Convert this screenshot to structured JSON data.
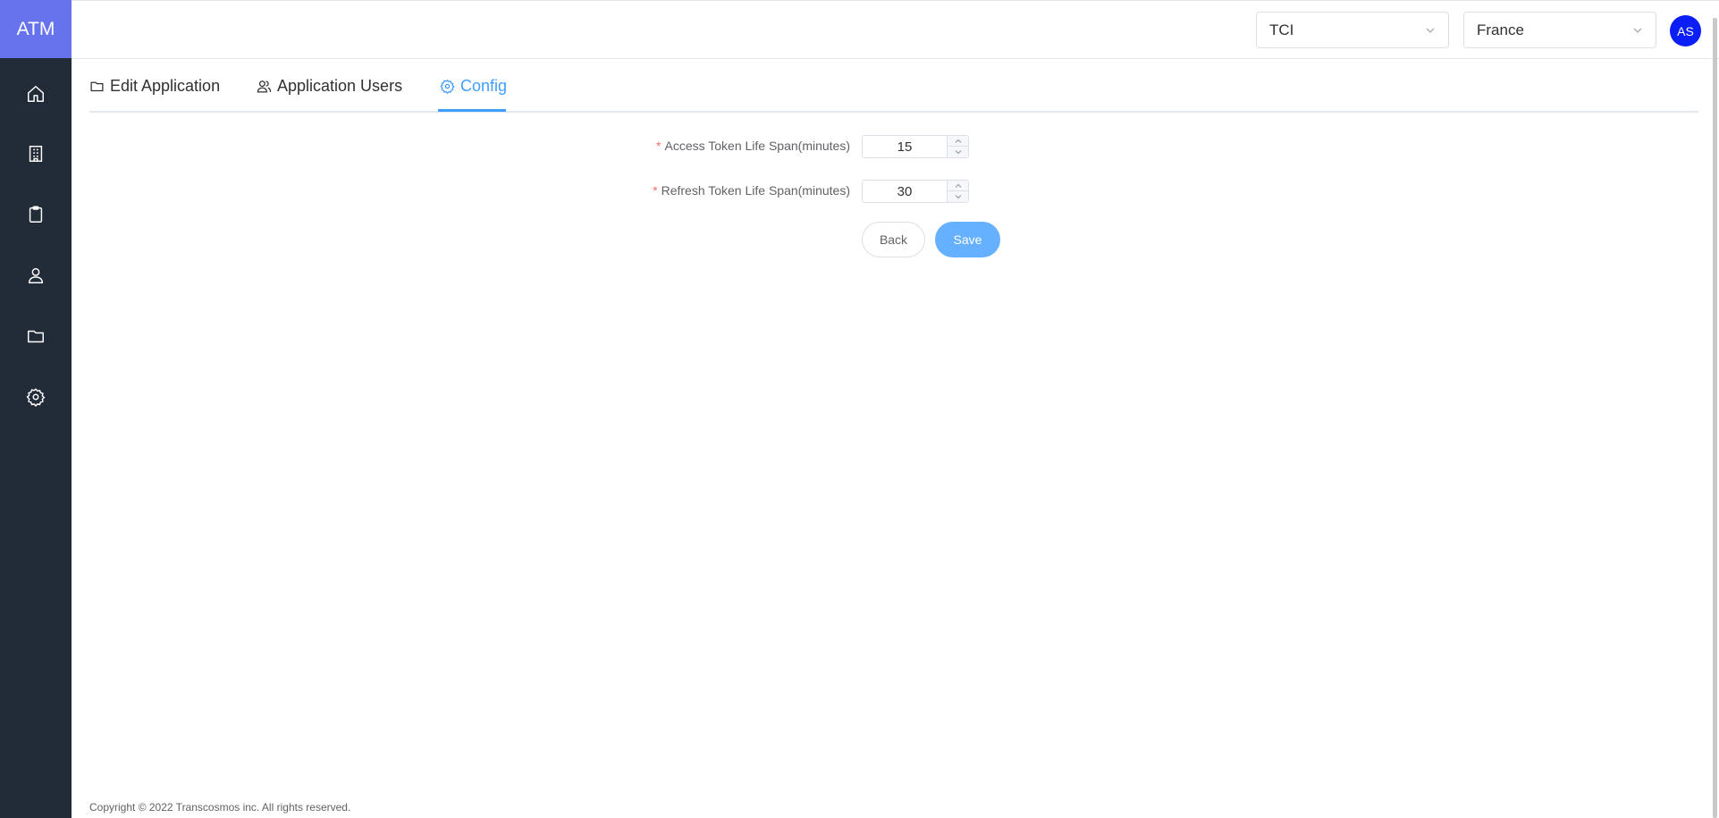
{
  "app": {
    "logo": "ATM"
  },
  "sidebar": {
    "items": [
      {
        "icon": "home-icon",
        "name": "sidebar-item-home"
      },
      {
        "icon": "building-icon",
        "name": "sidebar-item-organization"
      },
      {
        "icon": "clipboard-icon",
        "name": "sidebar-item-applications"
      },
      {
        "icon": "user-icon",
        "name": "sidebar-item-users"
      },
      {
        "icon": "folder-icon",
        "name": "sidebar-item-folders"
      },
      {
        "icon": "gear-icon",
        "name": "sidebar-item-settings"
      }
    ]
  },
  "header": {
    "company_select": {
      "value": "TCI"
    },
    "country_select": {
      "value": "France"
    },
    "avatar_initials": "AS"
  },
  "tabs": [
    {
      "label": "Edit Application",
      "icon": "folder-icon",
      "active": false
    },
    {
      "label": "Application Users",
      "icon": "users-icon",
      "active": false
    },
    {
      "label": "Config",
      "icon": "gear-icon",
      "active": true
    }
  ],
  "form": {
    "access_token": {
      "required_mark": "*",
      "label": "Access Token Life Span(minutes)",
      "value": "15"
    },
    "refresh_token": {
      "required_mark": "*",
      "label": "Refresh Token Life Span(minutes)",
      "value": "30"
    },
    "back_label": "Back",
    "save_label": "Save"
  },
  "footer": {
    "copyright": "Copyright © 2022 Transcosmos inc. All rights reserved."
  },
  "colors": {
    "sidebar_bg": "#222b38",
    "logo_bg": "#6673ed",
    "accent": "#409eff",
    "avatar_bg": "#0a1ef5",
    "required": "#f56c6c"
  }
}
